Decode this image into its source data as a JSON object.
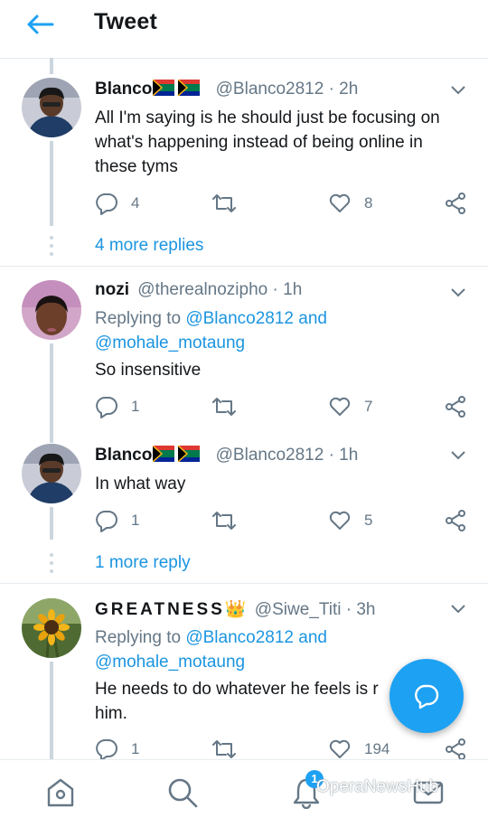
{
  "header": {
    "title": "Tweet"
  },
  "tweets": [
    {
      "name": "Blanco",
      "handle": "@Blanco2812",
      "time": "· 2h",
      "text": "All I'm saying is he should just be focusing on what's happening instead of being online in these tyms",
      "reply_count": "4",
      "like_count": "8",
      "more": "4 more replies"
    },
    {
      "name": "nozi",
      "handle": "@therealnozipho",
      "time": "· 1h",
      "replying_prefix": "Replying to",
      "replying_to_1": "@Blanco2812",
      "replying_and": "and",
      "replying_to_2": "@mohale_motaung",
      "text": "So insensitive",
      "reply_count": "1",
      "like_count": "7"
    },
    {
      "name": "Blanco",
      "handle": "@Blanco2812",
      "time": "· 1h",
      "text": "In what way",
      "reply_count": "1",
      "like_count": "5",
      "more": "1 more reply"
    },
    {
      "name": "GREATNESS",
      "name_emoji": "👑",
      "handle": "@Siwe_Titi",
      "time": "· 3h",
      "replying_prefix": "Replying to",
      "replying_to_1": "@Blanco2812",
      "replying_and": "and",
      "replying_to_2": "@mohale_motaung",
      "text_line1": "He needs to do whatever he feels is",
      "text_line1_end": "r",
      "text_line2": "him.",
      "reply_count": "1",
      "like_count": "194"
    }
  ],
  "bottom_nav": {
    "notifications_badge": "1"
  },
  "watermark": "OperaNewsHub",
  "colors": {
    "accent": "#1da1f2",
    "link": "#1b95e0",
    "muted": "#657786",
    "border": "#e6ecf0"
  }
}
